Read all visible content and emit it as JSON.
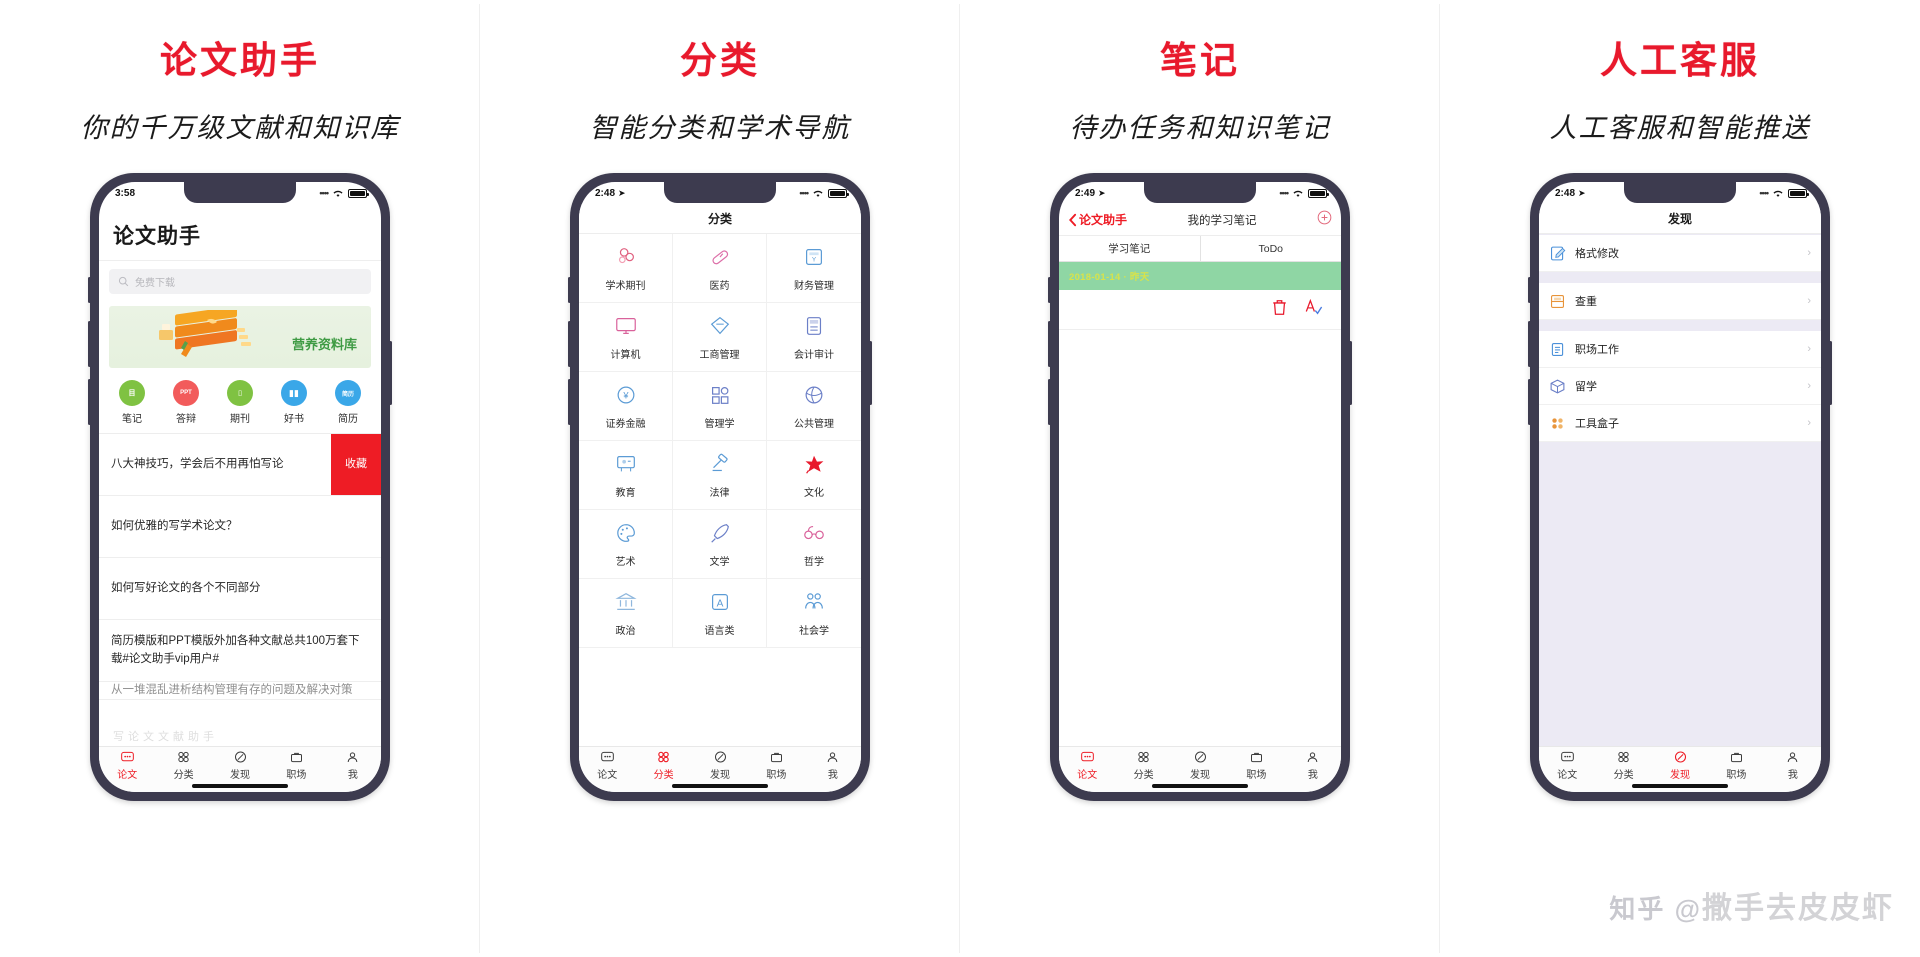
{
  "cards": [
    {
      "title": "论文助手",
      "subtitle": "你的千万级文献和知识库",
      "status": {
        "time": "3:58",
        "dots": "••••",
        "wifi": "wifi-icon",
        "battery": "battery-icon"
      },
      "app_title": "论文助手",
      "search": {
        "placeholder": "免费下载",
        "icon": "search-icon"
      },
      "banner": {
        "label": "营养资料库",
        "icon": "books-illustration"
      },
      "quick_actions": [
        {
          "label": "笔记",
          "color": "#7fc242",
          "glyph": "目",
          "icon": "note-icon"
        },
        {
          "label": "答辩",
          "color": "#f25b5b",
          "glyph": "PPT",
          "icon": "ppt-icon"
        },
        {
          "label": "期刊",
          "color": "#7fc242",
          "glyph": "▯",
          "icon": "journal-icon"
        },
        {
          "label": "好书",
          "color": "#3aa7e8",
          "glyph": "▮▮",
          "icon": "book-icon"
        },
        {
          "label": "简历",
          "color": "#3aa7e8",
          "glyph": "简历",
          "icon": "resume-icon"
        }
      ],
      "feed": [
        {
          "text": "八大神技巧，学会后不用再怕写论",
          "action": "收藏"
        },
        {
          "text": "如何优雅的写学术论文？"
        },
        {
          "text": "如何写好论文的各个不同部分"
        },
        {
          "text": "简历模版和PPT模版外加各种文献总共100万套下载#论文助手vip用户#"
        },
        {
          "text": "从一堆混乱进析结构管理有存的问题及解决对策"
        }
      ],
      "feed_watermark": "写论文文献助手",
      "tabs": [
        {
          "label": "论文",
          "icon": "paper-icon",
          "active": true
        },
        {
          "label": "分类",
          "icon": "grid-icon",
          "active": false
        },
        {
          "label": "发现",
          "icon": "compass-icon",
          "active": false
        },
        {
          "label": "职场",
          "icon": "briefcase-icon",
          "active": false
        },
        {
          "label": "我",
          "icon": "user-icon",
          "active": false
        }
      ]
    },
    {
      "title": "分类",
      "subtitle": "智能分类和学术导航",
      "status": {
        "time": "2:48",
        "loc": "➤",
        "dots": "••••",
        "wifi": "wifi-icon",
        "battery": "battery-icon"
      },
      "navbar": "分类",
      "grid": [
        {
          "label": "学术期刊",
          "icon": "molecule-icon",
          "color": "#e0607f"
        },
        {
          "label": "医药",
          "icon": "capsule-icon",
          "color": "#dd6fa8"
        },
        {
          "label": "财务管理",
          "icon": "folder-y-icon",
          "color": "#5b9bd5"
        },
        {
          "label": "计算机",
          "icon": "monitor-icon",
          "color": "#d9629b"
        },
        {
          "label": "工商管理",
          "icon": "diamond-icon",
          "color": "#5b9bd5"
        },
        {
          "label": "会计审计",
          "icon": "calc-icon",
          "color": "#6b7fc7"
        },
        {
          "label": "证券金融",
          "icon": "yuan-circle-icon",
          "color": "#5b9bd5"
        },
        {
          "label": "管理学",
          "icon": "qr-icon",
          "color": "#6b7fc7"
        },
        {
          "label": "公共管理",
          "icon": "globe-icon",
          "color": "#6b7fc7"
        },
        {
          "label": "教育",
          "icon": "blackboard-icon",
          "color": "#5b9bd5"
        },
        {
          "label": "法律",
          "icon": "gavel-icon",
          "color": "#5b9bd5"
        },
        {
          "label": "文化",
          "icon": "star-red-icon",
          "color": "#e8192c"
        },
        {
          "label": "艺术",
          "icon": "palette-icon",
          "color": "#5b9bd5"
        },
        {
          "label": "文学",
          "icon": "quill-icon",
          "color": "#6b7fc7"
        },
        {
          "label": "哲学",
          "icon": "glasses-icon",
          "color": "#d9629b"
        },
        {
          "label": "政治",
          "icon": "bank-icon",
          "color": "#8fb7dd"
        },
        {
          "label": "语言类",
          "icon": "letter-a-icon",
          "color": "#5b9bd5"
        },
        {
          "label": "社会学",
          "icon": "people-icon",
          "color": "#5b9bd5"
        }
      ],
      "tabs": [
        {
          "label": "论文",
          "icon": "paper-icon",
          "active": false
        },
        {
          "label": "分类",
          "icon": "grid-icon",
          "active": true
        },
        {
          "label": "发现",
          "icon": "compass-icon",
          "active": false
        },
        {
          "label": "职场",
          "icon": "briefcase-icon",
          "active": false
        },
        {
          "label": "我",
          "icon": "user-icon",
          "active": false
        }
      ]
    },
    {
      "title": "笔记",
      "subtitle": "待办任务和知识笔记",
      "status": {
        "time": "2:49",
        "loc": "➤",
        "dots": "••••",
        "wifi": "wifi-icon",
        "battery": "battery-icon"
      },
      "back_label": "论文助手",
      "nav_title": "我的学习笔记",
      "add_icon": "plus-circle-icon",
      "segments": [
        "学习笔记",
        "ToDo"
      ],
      "note": {
        "date": "2018-01-14 · 昨天"
      },
      "tools": [
        {
          "icon": "trash-icon",
          "color": "#e8192c"
        },
        {
          "icon": "font-check-icon",
          "color": "#e8192c"
        }
      ],
      "tabs": [
        {
          "label": "论文",
          "icon": "paper-icon",
          "active": true
        },
        {
          "label": "分类",
          "icon": "grid-icon",
          "active": false
        },
        {
          "label": "发现",
          "icon": "compass-icon",
          "active": false
        },
        {
          "label": "职场",
          "icon": "briefcase-icon",
          "active": false
        },
        {
          "label": "我",
          "icon": "user-icon",
          "active": false
        }
      ]
    },
    {
      "title": "人工客服",
      "subtitle": "人工客服和智能推送",
      "status": {
        "time": "2:48",
        "loc": "➤",
        "dots": "••••",
        "wifi": "wifi-icon",
        "battery": "battery-icon"
      },
      "navbar": "发现",
      "rows": [
        {
          "label": "格式修改",
          "icon": "edit-doc-icon",
          "color": "#4a90d9",
          "spacer_after": true
        },
        {
          "label": "查重",
          "icon": "scan-doc-icon",
          "color": "#e8943a",
          "spacer_after": true
        },
        {
          "label": "职场工作",
          "icon": "clipboard-icon",
          "color": "#4a90d9",
          "spacer_after": false
        },
        {
          "label": "留学",
          "icon": "box-icon",
          "color": "#6b7fc7",
          "spacer_after": false
        },
        {
          "label": "工具盒子",
          "icon": "dots-grid-icon",
          "color": "#e8943a",
          "spacer_after": false
        }
      ],
      "watermark": "撒手去皮皮虾",
      "watermark_prefix": "知乎 @",
      "tabs": [
        {
          "label": "论文",
          "icon": "paper-icon",
          "active": false
        },
        {
          "label": "分类",
          "icon": "grid-icon",
          "active": false
        },
        {
          "label": "发现",
          "icon": "compass-icon",
          "active": true
        },
        {
          "label": "职场",
          "icon": "briefcase-icon",
          "active": false
        },
        {
          "label": "我",
          "icon": "user-icon",
          "active": false
        }
      ]
    }
  ],
  "colors": {
    "accent_red": "#ee1c25",
    "title_red": "#e8192c",
    "frame": "#3d3b4f",
    "note_green": "#8fd6a4"
  }
}
